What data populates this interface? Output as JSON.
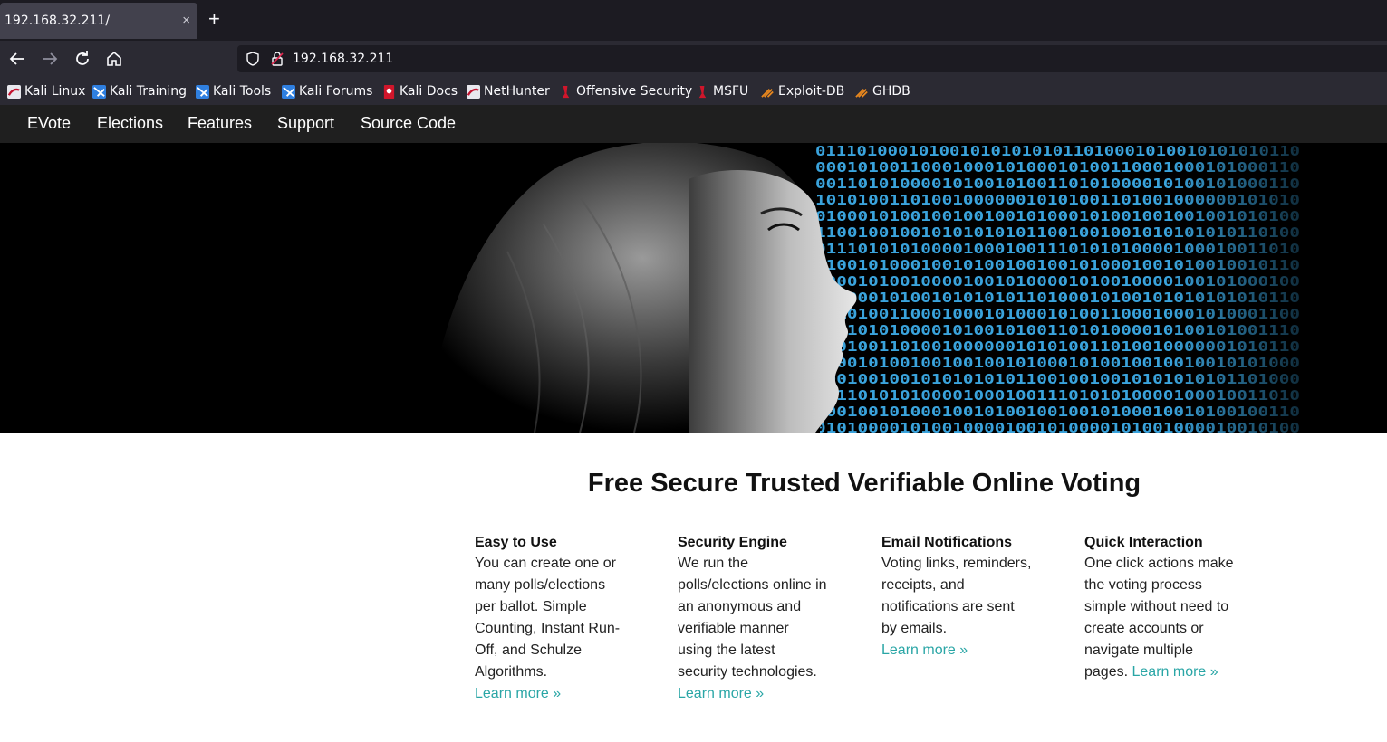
{
  "browser": {
    "tab_title": "192.168.32.211/",
    "tab_close": "×",
    "new_tab": "+",
    "url": "192.168.32.211",
    "bookmarks": [
      {
        "label": "Kali Linux",
        "icon": "kali-dragon-icon"
      },
      {
        "label": "Kali Training",
        "icon": "kali-training-icon"
      },
      {
        "label": "Kali Tools",
        "icon": "kali-tools-icon"
      },
      {
        "label": "Kali Forums",
        "icon": "kali-forums-icon"
      },
      {
        "label": "Kali Docs",
        "icon": "kali-docs-icon"
      },
      {
        "label": "NetHunter",
        "icon": "nethunter-icon"
      },
      {
        "label": "Offensive Security",
        "icon": "offsec-icon"
      },
      {
        "label": "MSFU",
        "icon": "msfu-icon"
      },
      {
        "label": "Exploit-DB",
        "icon": "exploitdb-icon"
      },
      {
        "label": "GHDB",
        "icon": "ghdb-icon"
      }
    ]
  },
  "site": {
    "nav": [
      "EVote",
      "Elections",
      "Features",
      "Support",
      "Source Code"
    ],
    "hero_binary": [
      "01110100010100101010101011010001010010101010110",
      "0001010011000100010100010100110001000101000110",
      "0011010100001010010100110101000010100101000110",
      "1010100110100100000010101001101001000000101010",
      "0100010100100100100101000101001001001001010100",
      "1100100100101010101011001001001010101010110100",
      "0111010101000010001001110101010000100010011010",
      "0100101000100101001001001010001001010010010110",
      "0000101001000010010100001010010000100101000100",
      "0010001010010101010110100010100101010101010110",
      "0010100110001000101000101001100010001010001100",
      "0111010100001010010100110101000010100101001110",
      "1101001101001000000101010011010010000001010110",
      "0000101001001001001010001010010010010010101000",
      "1001001001010101010110010010010101010101101000",
      "0111010101000010001001110101010000100010011010",
      "0001001010001001010010010010100010010100100110",
      "0101000010100100001001010000101001000010010100"
    ],
    "headline": "Free Secure Trusted Verifiable Online Voting",
    "features": [
      {
        "title": "Easy to Use",
        "lines": [
          "You can create one or",
          "many polls/elections",
          "per ballot. Simple",
          "Counting, Instant Run-",
          "Off, and Schulze",
          "Algorithms."
        ],
        "tail": "",
        "link": "Learn more »"
      },
      {
        "title": "Security Engine",
        "lines": [
          "We run the",
          "polls/elections online in",
          "an anonymous and",
          "verifiable manner",
          "using the latest",
          "security technologies."
        ],
        "tail": "",
        "link": "Learn more »"
      },
      {
        "title": "Email Notifications",
        "lines": [
          "Voting links, reminders,",
          "receipts, and",
          "notifications are sent",
          "by emails."
        ],
        "tail": "",
        "link": "Learn more »"
      },
      {
        "title": "Quick Interaction",
        "lines": [
          "One click actions make",
          "the voting process",
          "simple without need to",
          "create accounts or",
          "navigate multiple"
        ],
        "tail": "pages.",
        "link": "Learn more »"
      }
    ]
  },
  "colors": {
    "accent_link": "#2aa6a6",
    "nav_bg": "#1f1f1f",
    "binary_blue": "#3aa3dc"
  }
}
